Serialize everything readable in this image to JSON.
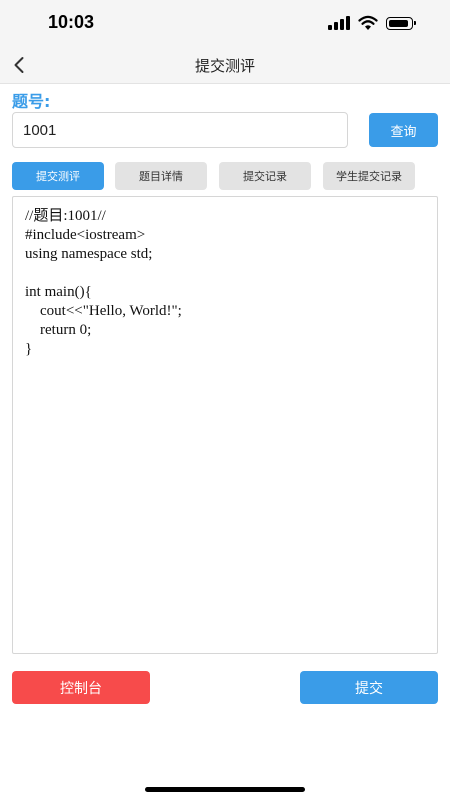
{
  "status_bar": {
    "time": "10:03",
    "icons": [
      "signal-icon",
      "wifi-icon",
      "battery-icon"
    ]
  },
  "nav": {
    "title": "提交测评",
    "back_icon": "chevron-left-icon"
  },
  "problem": {
    "label": "题号:",
    "input_value": "1001",
    "query_label": "查询"
  },
  "tabs": [
    {
      "label": "提交测评",
      "active": true
    },
    {
      "label": "题目详情",
      "active": false
    },
    {
      "label": "提交记录",
      "active": false
    },
    {
      "label": "学生提交记录",
      "active": false
    }
  ],
  "editor": {
    "code": "//题目:1001//\n#include<iostream>\nusing namespace std;\n\nint main(){\n    cout<<\"Hello, World!\";\n    return 0;\n}"
  },
  "actions": {
    "console_label": "控制台",
    "submit_label": "提交"
  },
  "colors": {
    "accent": "#3a9ce8",
    "danger": "#f74b4b",
    "tab_inactive": "#e3e3e3"
  }
}
